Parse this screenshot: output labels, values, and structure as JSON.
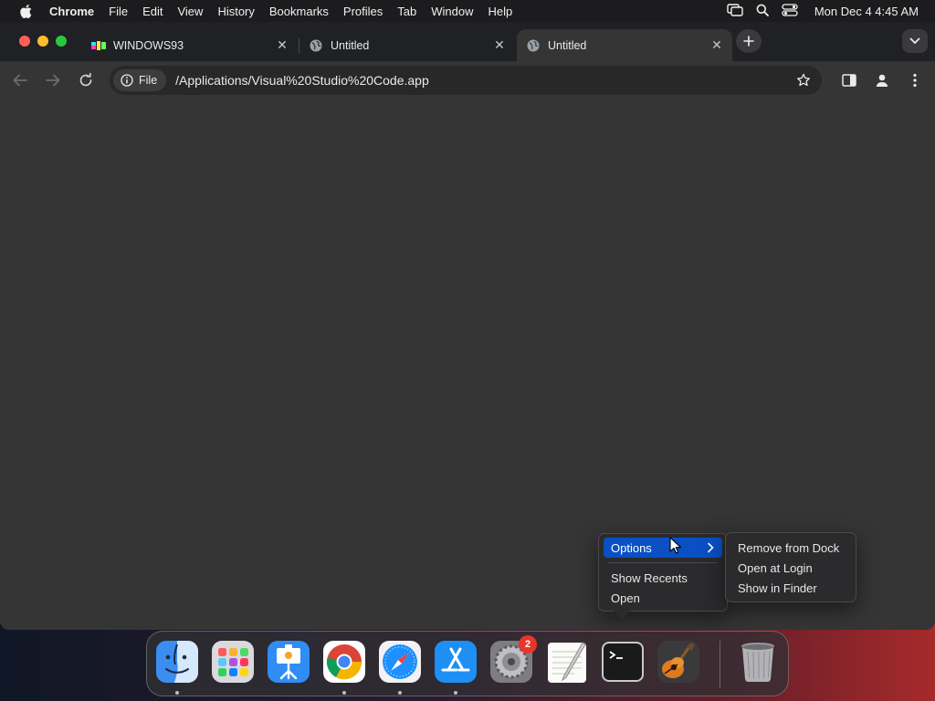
{
  "menubar": {
    "app": "Chrome",
    "items": [
      "File",
      "Edit",
      "View",
      "History",
      "Bookmarks",
      "Profiles",
      "Tab",
      "Window",
      "Help"
    ],
    "clock": "Mon Dec 4  4:45 AM"
  },
  "tabs": [
    {
      "title": "WINDOWS93",
      "favicon": "windows93-icon",
      "active": false
    },
    {
      "title": "Untitled",
      "favicon": "globe-icon",
      "active": false
    },
    {
      "title": "Untitled",
      "favicon": "globe-icon",
      "active": true
    }
  ],
  "omnibox": {
    "chip_label": "File",
    "url": "/Applications/Visual%20Studio%20Code.app"
  },
  "context_menu": {
    "options_label": "Options",
    "items": [
      "Show Recents",
      "Open"
    ]
  },
  "submenu": {
    "items": [
      "Remove from Dock",
      "Open at Login",
      "Show in Finder"
    ]
  },
  "dock": {
    "apps": [
      {
        "name": "Finder",
        "icon": "finder-icon",
        "running": true
      },
      {
        "name": "Launchpad",
        "icon": "launchpad-icon",
        "running": false
      },
      {
        "name": "Keynote",
        "icon": "keynote-icon",
        "running": false
      },
      {
        "name": "Google Chrome",
        "icon": "chrome-icon",
        "running": true
      },
      {
        "name": "Safari",
        "icon": "safari-icon",
        "running": true
      },
      {
        "name": "App Store",
        "icon": "app-store-icon",
        "running": true
      },
      {
        "name": "System Settings",
        "icon": "settings-icon",
        "running": false,
        "badge": "2"
      },
      {
        "name": "TextEdit",
        "icon": "textedit-icon",
        "running": false
      },
      {
        "name": "Terminal",
        "icon": "terminal-icon",
        "running": false
      },
      {
        "name": "GarageBand",
        "icon": "garageband-icon",
        "running": false
      }
    ],
    "trash": {
      "name": "Trash",
      "icon": "trash-icon"
    }
  }
}
